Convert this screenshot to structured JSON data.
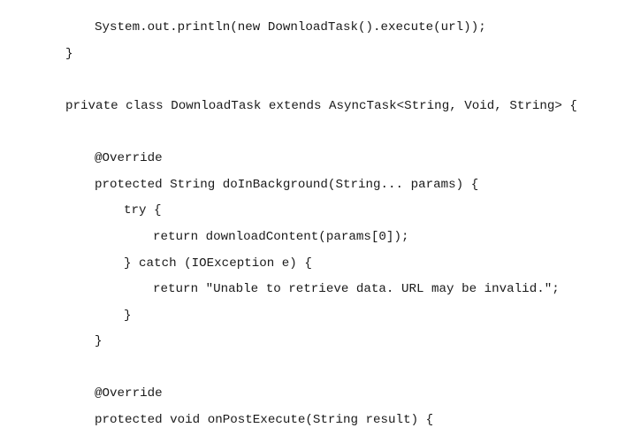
{
  "document": {
    "code_lines": [
      "System.out.println(new DownloadTask().execute(url));",
      "}",
      "private class DownloadTask extends AsyncTask<String, Void, String> {",
      "@Override",
      "protected String doInBackground(String... params) {",
      "try {",
      "return downloadContent(params[0]);",
      "} catch (IOException e) {",
      "return \"Unable to retrieve data. URL may be invalid.\";",
      "}",
      "}",
      "@Override",
      "protected void onPostExecute(String result) {"
    ]
  }
}
